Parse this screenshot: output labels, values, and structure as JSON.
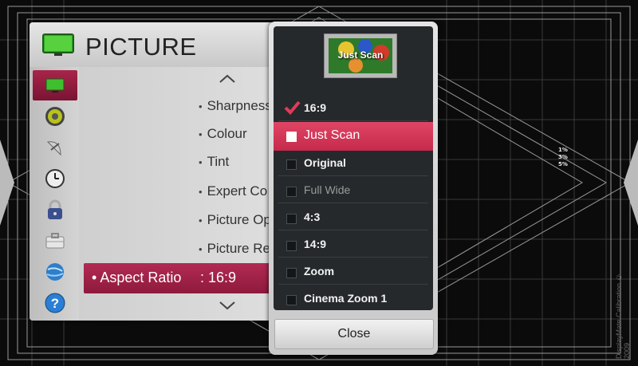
{
  "background": {
    "percent_markers": [
      "1%",
      "3%",
      "5%"
    ],
    "credit": "DisplayMate Calibration © 2009"
  },
  "menu": {
    "title": "PICTURE",
    "sidebar": [
      {
        "icon": "picture-icon",
        "active": true
      },
      {
        "icon": "speaker-icon",
        "active": false
      },
      {
        "icon": "satellite-dish-icon",
        "active": false
      },
      {
        "icon": "clock-icon",
        "active": false
      },
      {
        "icon": "lock-icon",
        "active": false
      },
      {
        "icon": "toolbox-icon",
        "active": false
      },
      {
        "icon": "network-globe-icon",
        "active": false
      },
      {
        "icon": "help-icon",
        "active": false
      }
    ],
    "items": [
      "Sharpness",
      "Colour",
      "Tint",
      "Expert Co",
      "Picture Op",
      "Picture Re"
    ],
    "selected_item": {
      "label": "Aspect Ratio",
      "value": ": 16:9"
    }
  },
  "popup": {
    "preview_label": "Just Scan",
    "options": [
      {
        "label": "16:9",
        "state": "checked"
      },
      {
        "label": "Just Scan",
        "state": "highlighted"
      },
      {
        "label": "Original",
        "state": "normal"
      },
      {
        "label": "Full Wide",
        "state": "disabled"
      },
      {
        "label": "4:3",
        "state": "normal"
      },
      {
        "label": "14:9",
        "state": "normal"
      },
      {
        "label": "Zoom",
        "state": "normal"
      },
      {
        "label": "Cinema Zoom 1",
        "state": "normal"
      }
    ],
    "close_label": "Close"
  },
  "colors": {
    "accent": "#c62a4c",
    "sidebar_active": "#8d1a3c",
    "popup_bg": "#26292c"
  }
}
